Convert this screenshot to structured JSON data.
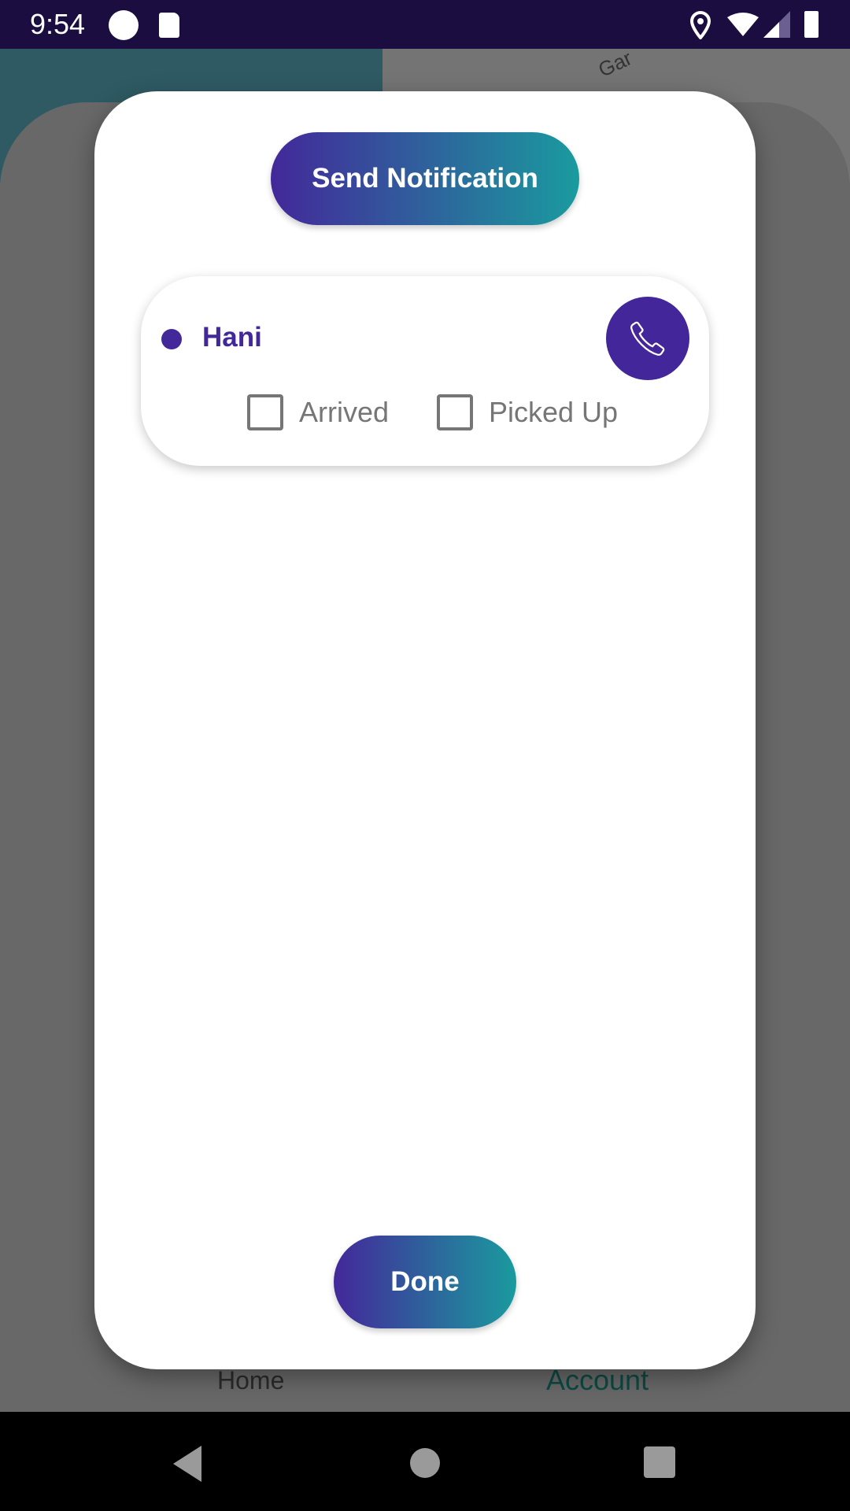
{
  "status_bar": {
    "time": "9:54"
  },
  "map": {
    "label_fragment": "Gar"
  },
  "dialog": {
    "send_button": "Send Notification",
    "passengers": [
      {
        "name": "Hani",
        "arrived_label": "Arrived",
        "arrived": false,
        "picked_up_label": "Picked Up",
        "picked_up": false
      }
    ],
    "done_button": "Done"
  },
  "bottom_tabs": {
    "home": "Home",
    "account": "Account"
  },
  "colors": {
    "primary": "#43289a",
    "accent": "#1a9b9e",
    "status_bar": "#1b0d40"
  }
}
